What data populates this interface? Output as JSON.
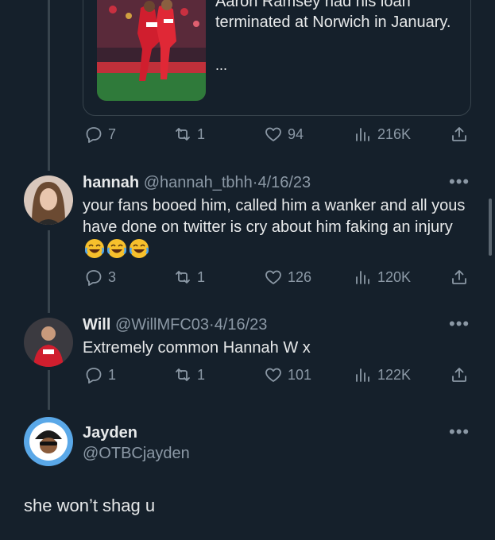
{
  "quoted_tweet": {
    "text_partial_top": "Aaron Ramsey had his loan",
    "text": "terminated at Norwich in January.",
    "ellipsis": "...",
    "image_icon": "football-players-photo"
  },
  "main_tweet_actions": {
    "replies": "7",
    "retweets": "1",
    "likes": "94",
    "views": "216K"
  },
  "replies": [
    {
      "name": "hannah",
      "handle": "@hannah_tbhh",
      "separator": "·",
      "date": "4/16/23",
      "text": "your fans booed him, called him a wanker and all yous have done on twitter is cry about him faking an injury",
      "emoji": [
        "face-with-tears-of-joy",
        "face-with-tears-of-joy",
        "face-with-tears-of-joy"
      ],
      "replies": "3",
      "retweets": "1",
      "likes": "126",
      "views": "120K"
    },
    {
      "name": "Will",
      "handle": "@WillMFC03",
      "separator": "·",
      "date": "4/16/23",
      "text": "Extremely common Hannah W x",
      "replies": "1",
      "retweets": "1",
      "likes": "101",
      "views": "122K"
    }
  ],
  "profile": {
    "name": "Jayden",
    "handle": "@OTBCjayden"
  },
  "composer_reply": "she won’t shag u",
  "more_label": "•••",
  "colors": {
    "background": "#15202b",
    "muted": "#8b98a5",
    "text": "#e7e9ea",
    "border": "#38444d"
  }
}
